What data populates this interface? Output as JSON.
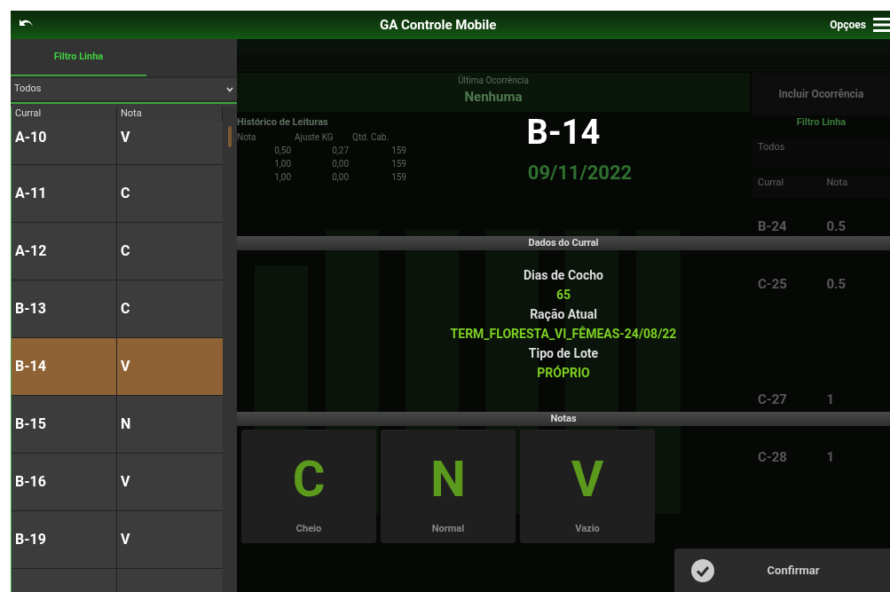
{
  "app_bar": {
    "title": "GA Controle Mobile",
    "options_label": "Opçoes"
  },
  "left_panel": {
    "tabs": [
      {
        "label": "Filtro Linha",
        "selected": true
      }
    ],
    "filter": {
      "value": "Todos"
    },
    "columns": [
      "Curral",
      "Nota"
    ],
    "rows": [
      {
        "curral": "A-10",
        "nota": "V",
        "selected": false
      },
      {
        "curral": "A-11",
        "nota": "C",
        "selected": false
      },
      {
        "curral": "A-12",
        "nota": "C",
        "selected": false
      },
      {
        "curral": "B-13",
        "nota": "C",
        "selected": false
      },
      {
        "curral": "B-14",
        "nota": "V",
        "selected": true
      },
      {
        "curral": "B-15",
        "nota": "N",
        "selected": false
      },
      {
        "curral": "B-16",
        "nota": "V",
        "selected": false
      },
      {
        "curral": "B-19",
        "nota": "V",
        "selected": false
      }
    ]
  },
  "background": {
    "last_occurrence_label": "Última Ocorrência",
    "last_occurrence": "Nenhuma",
    "history_title": "Histórico de Leituras",
    "history_columns": [
      "Nota",
      "Ajuste KG",
      "Qtd. Cab."
    ],
    "history_rows": [
      [
        "0,50",
        "0,27",
        "159"
      ],
      [
        "1,00",
        "0,00",
        "159"
      ],
      [
        "1,00",
        "0,00",
        "159"
      ]
    ],
    "date": "09/11/2022",
    "include_button": "Incluir Ocorrência",
    "side_tab": "Filtro Linha",
    "side_filter": "Todos",
    "side_columns": [
      "Curral",
      "Nota"
    ],
    "side_rows": [
      [
        "B-24",
        "0.5"
      ],
      [
        "C-25",
        "0.5"
      ],
      [
        "C-27",
        "1"
      ],
      [
        "C-28",
        "1"
      ]
    ]
  },
  "dialog": {
    "title": "B-14",
    "section_title": "Dados do Curral",
    "fields": [
      {
        "label": "Dias de Cocho",
        "value": "65"
      },
      {
        "label": "Ração Atual",
        "value": "TERM_FLORESTA_VI_FÊMEAS-24/08/22"
      },
      {
        "label": "Tipo de Lote",
        "value": "PRÓPRIO"
      }
    ],
    "notes_title": "Notas",
    "notes": [
      {
        "letter": "C",
        "label": "Cheio"
      },
      {
        "letter": "N",
        "label": "Normal"
      },
      {
        "letter": "V",
        "label": "Vazio"
      }
    ],
    "confirm_button": "Confirmar"
  }
}
